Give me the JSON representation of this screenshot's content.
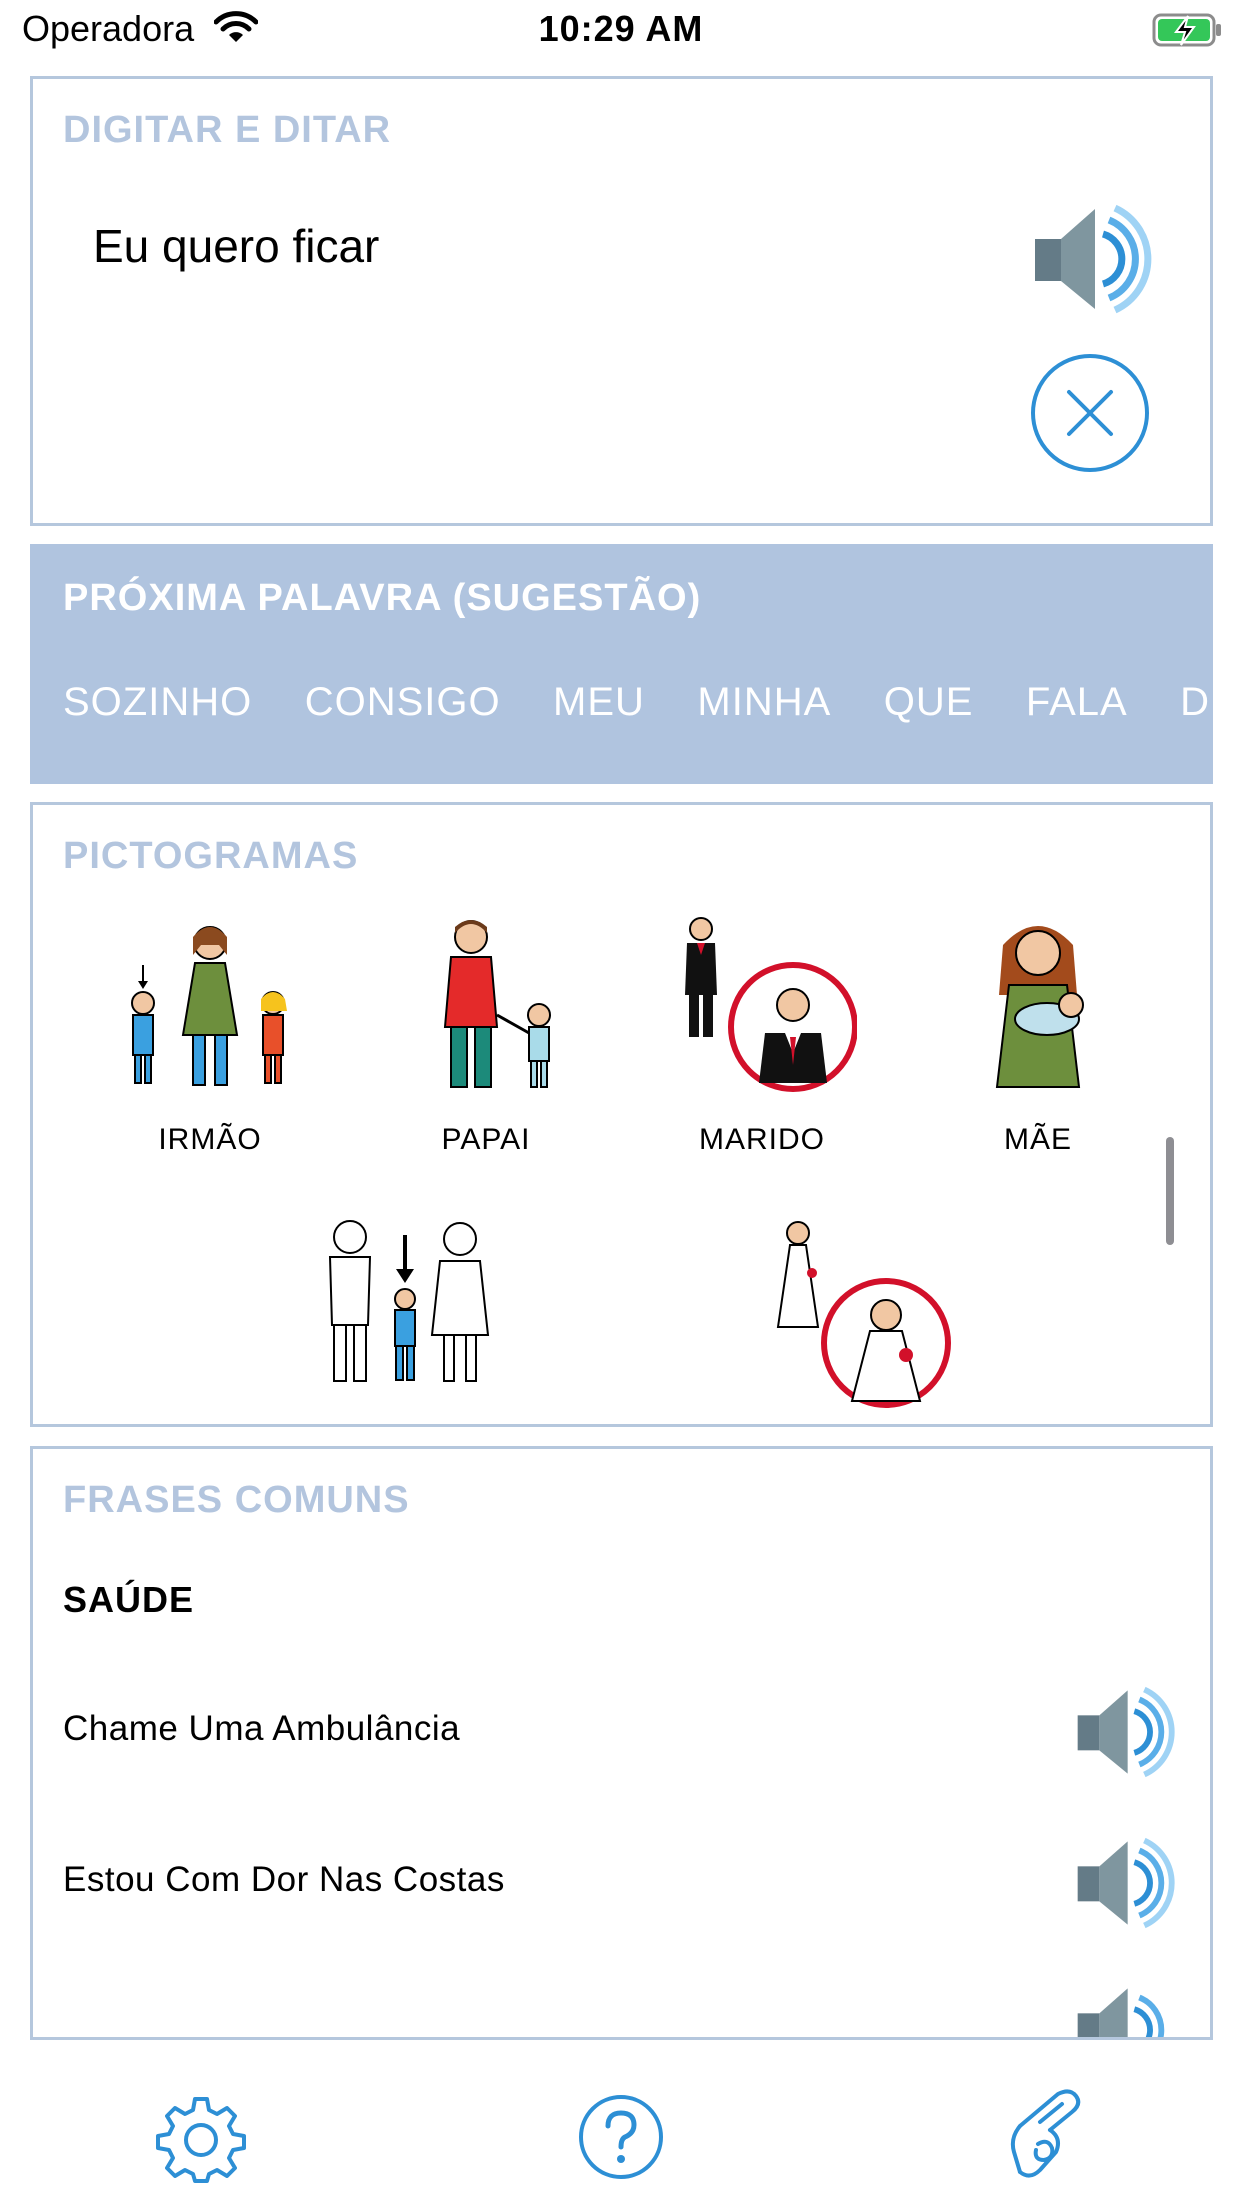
{
  "status_bar": {
    "carrier": "Operadora",
    "time": "10:29 AM"
  },
  "typing": {
    "title": "DIGITAR E DITAR",
    "text": "Eu quero ficar"
  },
  "suggestions": {
    "title": "PRÓXIMA PALAVRA (SUGESTÃO)",
    "words": [
      "SOZINHO",
      "CONSIGO",
      "MEU",
      "MINHA",
      "QUE",
      "FALA",
      "D"
    ]
  },
  "pictograms": {
    "title": "PICTOGRAMAS",
    "items": [
      {
        "label": "IRMÃO",
        "icon": "siblings-icon"
      },
      {
        "label": "PAPAI",
        "icon": "father-icon"
      },
      {
        "label": "MARIDO",
        "icon": "husband-icon"
      },
      {
        "label": "MÃE",
        "icon": "mother-icon"
      },
      {
        "label": "",
        "icon": "child-of-parents-icon"
      },
      {
        "label": "",
        "icon": "bride-icon"
      }
    ]
  },
  "phrases": {
    "title": "FRASES COMUNS",
    "category": "SAÚDE",
    "items": [
      {
        "text": "Chame Uma Ambulância"
      },
      {
        "text": "Estou Com Dor Nas Costas"
      }
    ]
  },
  "colors": {
    "accent": "#2d8fd5",
    "section_title": "#b3c5de",
    "suggestion_bg": "#b0c4df",
    "card_border": "#b5c7dd"
  }
}
